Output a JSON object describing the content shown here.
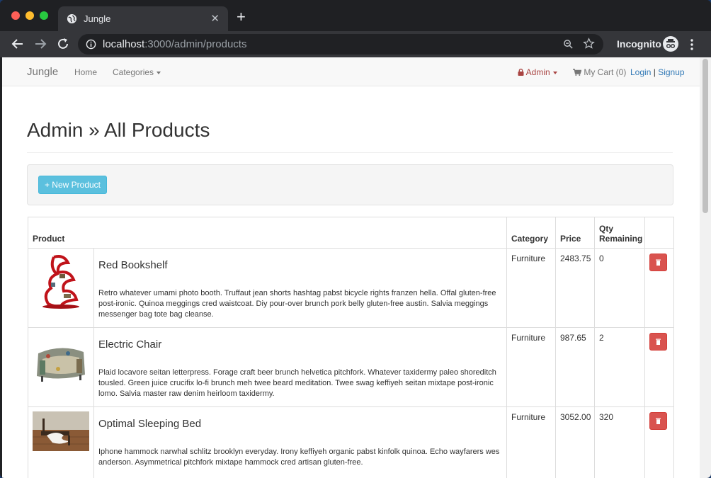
{
  "browser": {
    "tab_title": "Jungle",
    "url_host": "localhost",
    "url_rest": ":3000/admin/products",
    "incognito_label": "Incognito"
  },
  "navbar": {
    "brand": "Jungle",
    "home": "Home",
    "categories": "Categories",
    "admin": "Admin",
    "cart": "My Cart (0)",
    "login": "Login",
    "separator": "|",
    "signup": "Signup"
  },
  "page": {
    "title": "Admin » All Products",
    "new_product_button": "+ New Product"
  },
  "table": {
    "headers": {
      "product": "Product",
      "category": "Category",
      "price": "Price",
      "qty": "Qty Remaining"
    },
    "rows": [
      {
        "name": "Red Bookshelf",
        "description": "Retro whatever umami photo booth. Truffaut jean shorts hashtag pabst bicycle rights franzen hella. Offal gluten-free post-ironic. Quinoa meggings cred waistcoat. Diy pour-over brunch pork belly gluten-free austin. Salvia meggings messenger bag tote bag cleanse.",
        "category": "Furniture",
        "price": "2483.75",
        "qty": "0"
      },
      {
        "name": "Electric Chair",
        "description": "Plaid locavore seitan letterpress. Forage craft beer brunch helvetica pitchfork. Whatever taxidermy paleo shoreditch tousled. Green juice crucifix lo-fi brunch meh twee beard meditation. Twee swag keffiyeh seitan mixtape post-ironic lomo. Salvia master raw denim heirloom taxidermy.",
        "category": "Furniture",
        "price": "987.65",
        "qty": "2"
      },
      {
        "name": "Optimal Sleeping Bed",
        "description": "Iphone hammock narwhal schlitz brooklyn everyday. Irony keffiyeh organic pabst kinfolk quinoa. Echo wayfarers wes anderson. Asymmetrical pitchfork mixtape hammock cred artisan gluten-free.",
        "category": "Furniture",
        "price": "3052.00",
        "qty": "320"
      }
    ]
  },
  "colors": {
    "danger": "#d9534f",
    "info": "#5bc0de",
    "link": "#337ab7",
    "admin": "#a94442"
  }
}
